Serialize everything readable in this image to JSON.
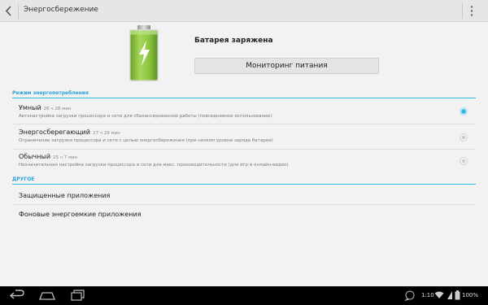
{
  "header": {
    "title": "Энергосбережение"
  },
  "battery": {
    "status": "Батарея заряжена",
    "monitor_button": "Мониторинг питания"
  },
  "mode_section": {
    "title": "Режим энергопотребления",
    "modes": [
      {
        "name": "Умный",
        "time": "26 ч 28 мин",
        "description": "Автонастройка загрузки процессора и сети для сбалансированной работы (повседневное использование)",
        "selected": true
      },
      {
        "name": "Энергосберегающий",
        "time": "27 ч 29 мин",
        "description": "Ограничение загрузки процессора и сети с целью энергосбережения (при низком уровне заряда батареи)",
        "selected": false
      },
      {
        "name": "Обычный",
        "time": "25 ч 7 мин",
        "description": "Незначительная настройка загрузки процессора и сети для макс. производительности (для игр и онлайн-видео)",
        "selected": false
      }
    ]
  },
  "other_section": {
    "title": "ДРУГОЕ",
    "items": [
      "Защищенные приложения",
      "Фоновые энергоемкие приложения"
    ]
  },
  "statusbar": {
    "time": "1:10",
    "battery": "100%"
  },
  "colors": {
    "accent": "#33b5e5",
    "battery_green": "#8bc34a"
  }
}
